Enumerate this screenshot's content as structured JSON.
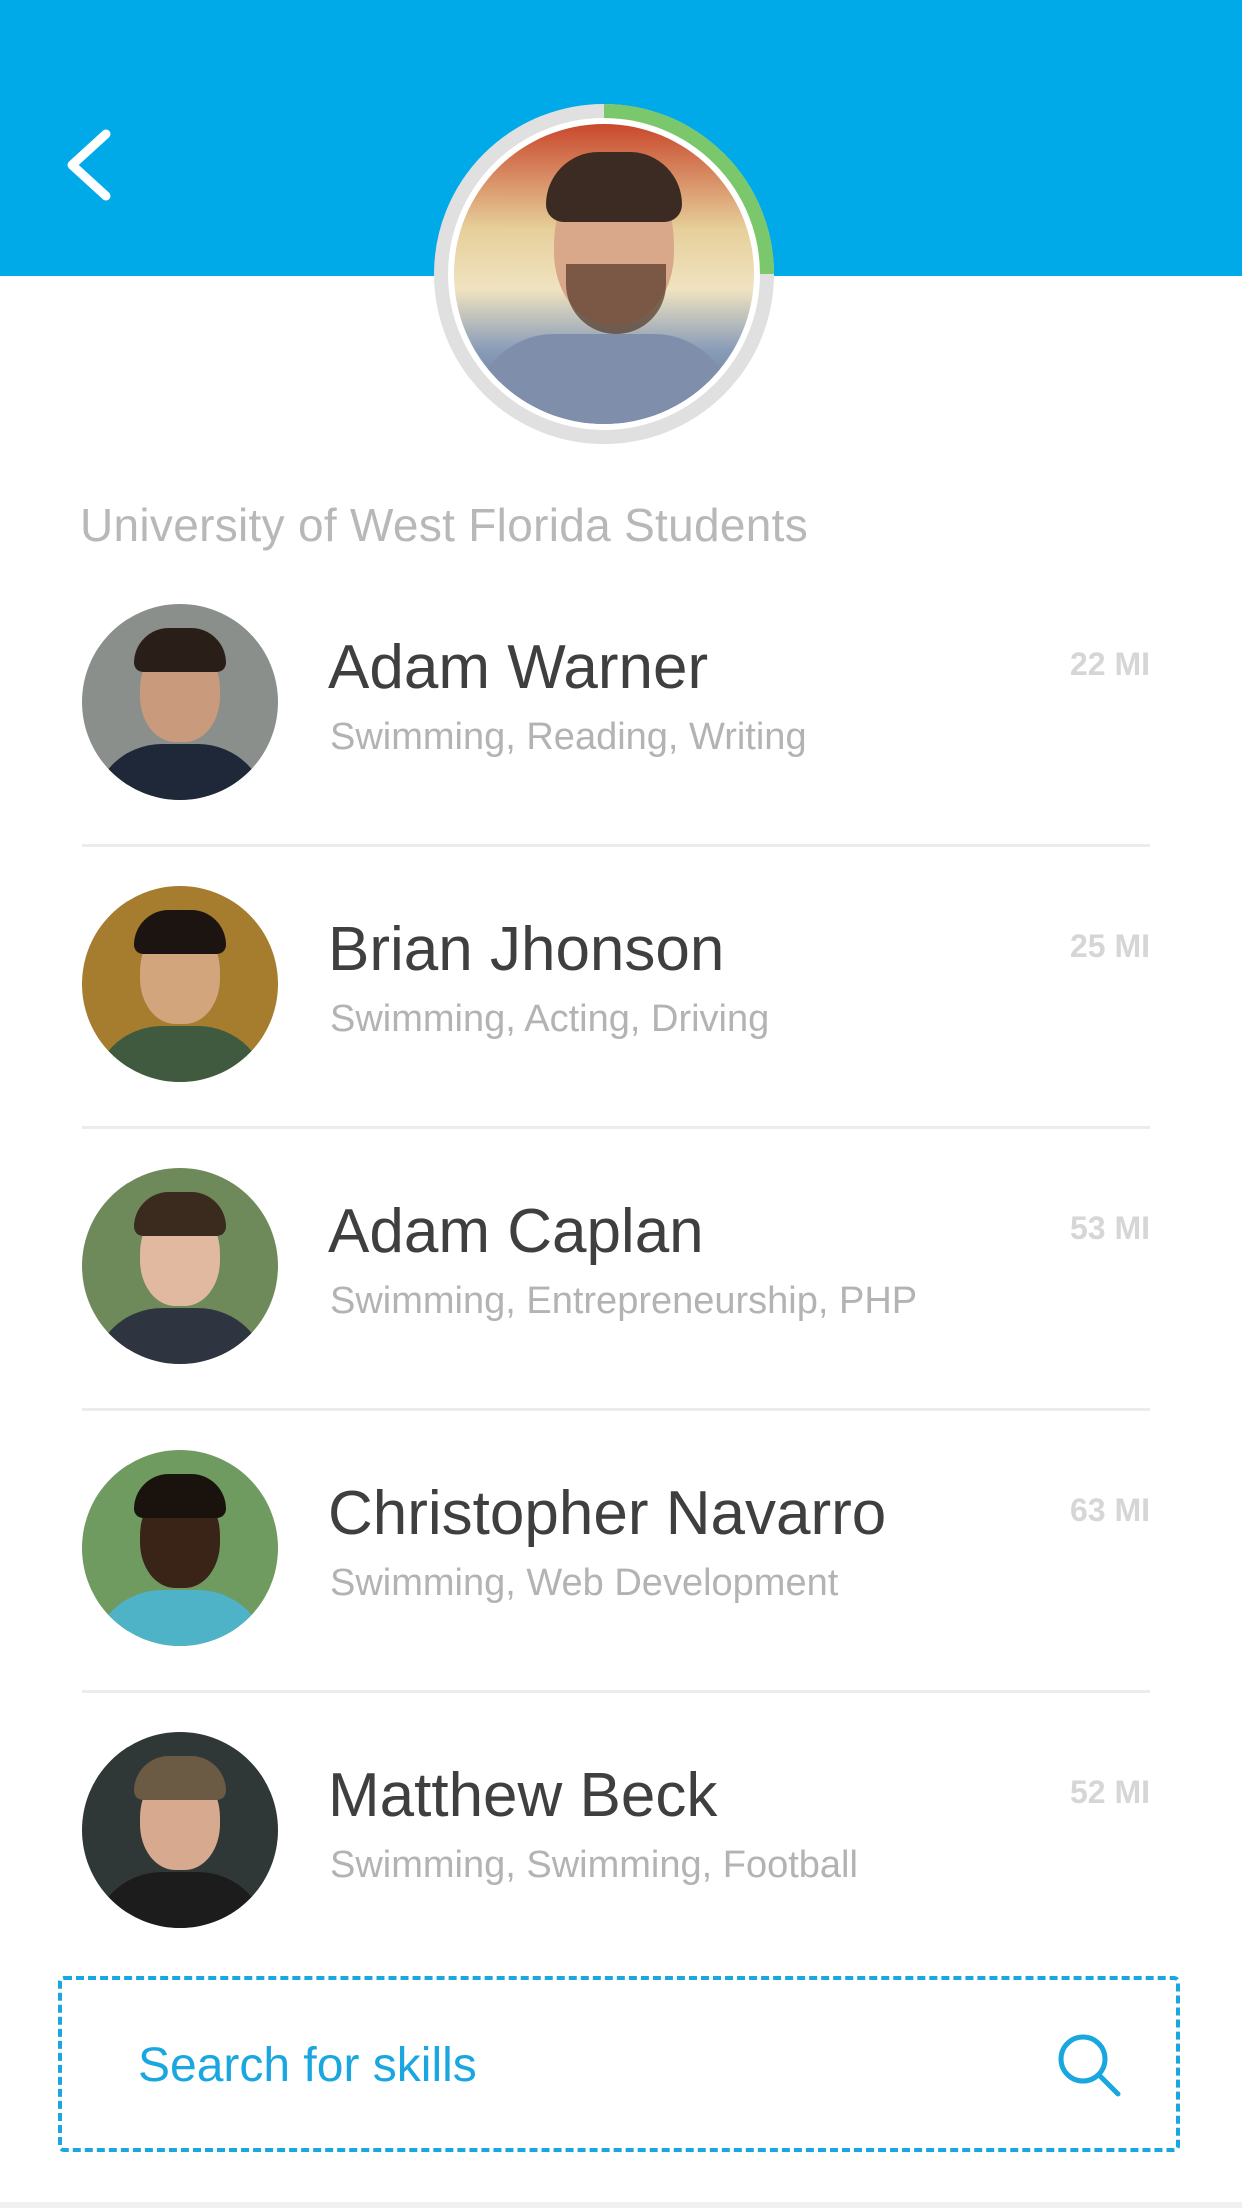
{
  "header": {
    "back_icon": "chevron-left-icon",
    "background_color": "#00a9e8",
    "profile": {
      "progress_fraction": 0.25,
      "progress_color": "#7bc86c",
      "ring_color": "#e0e0e0"
    }
  },
  "group_title": "University of West Florida Students",
  "people": [
    {
      "name": "Adam Warner",
      "skills": "Swimming, Reading, Writing",
      "distance": "22 MI",
      "palette": {
        "bg": "#8a8f8c",
        "face": "#c99b7c",
        "hair": "#2a1f18",
        "body": "#1e2838"
      }
    },
    {
      "name": "Brian Jhonson",
      "skills": "Swimming, Acting, Driving",
      "distance": "25 MI",
      "palette": {
        "bg": "#a67c2e",
        "face": "#d2a57c",
        "hair": "#1b1410",
        "body": "#3f5a3e"
      }
    },
    {
      "name": "Adam Caplan",
      "skills": "Swimming, Entrepreneurship, PHP",
      "distance": "53 MI",
      "palette": {
        "bg": "#6f8a5a",
        "face": "#e0b9a0",
        "hair": "#3b2a1e",
        "body": "#2f3540"
      }
    },
    {
      "name": "Christopher Navarro",
      "skills": "Swimming, Web Development",
      "distance": "63 MI",
      "palette": {
        "bg": "#6f9a60",
        "face": "#3a2418",
        "hair": "#1a120c",
        "body": "#4fb3c8"
      }
    },
    {
      "name": "Matthew Beck",
      "skills": "Swimming, Swimming, Football",
      "distance": "52 MI",
      "palette": {
        "bg": "#2f3836",
        "face": "#d7a98f",
        "hair": "#6b5a44",
        "body": "#1c1c1c"
      }
    }
  ],
  "search": {
    "placeholder": "Search for skills",
    "icon": "search-icon",
    "accent_color": "#1aa7e0"
  }
}
